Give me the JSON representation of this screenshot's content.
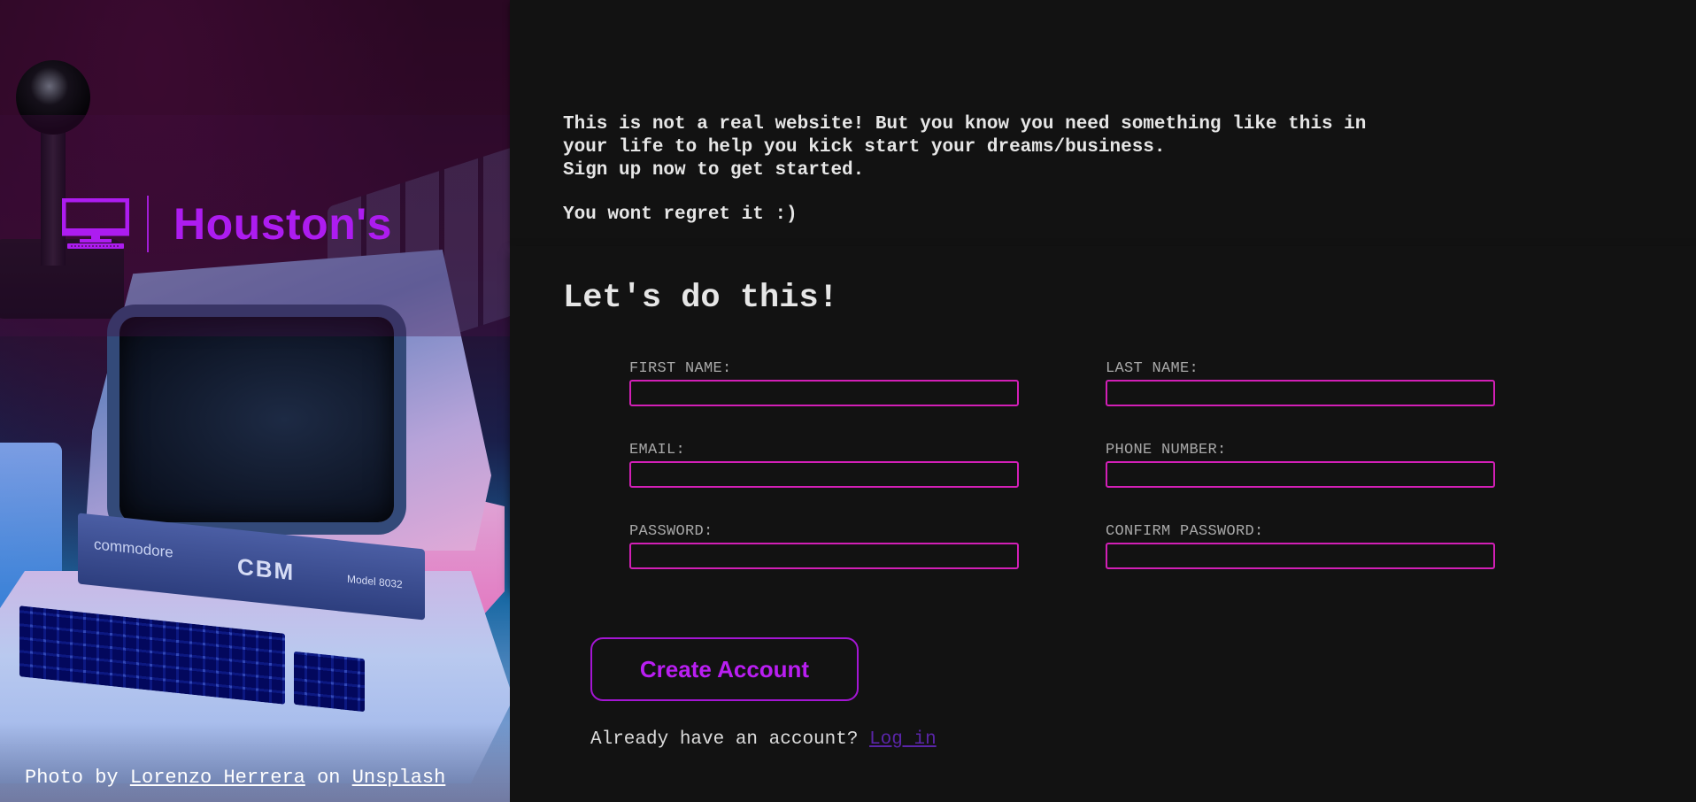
{
  "brand": {
    "name": "Houston's",
    "icon": "computer-monitor-icon",
    "color": "#ad1cf0"
  },
  "hero": {
    "photo_subject": "commodore-cbm-computer-photo",
    "plate_brand": "commodore",
    "plate_cbm": "CBM",
    "plate_model": "Model 8032",
    "credit_prefix": "Photo by ",
    "credit_author": "Lorenzo Herrera",
    "credit_middle": " on ",
    "credit_source": "Unsplash"
  },
  "intro": {
    "paragraph": "This is not a real website! But you know you need something like this in\nyour life to help you kick start your dreams/business.\nSign up now to get started.",
    "tagline": "You wont regret it :)"
  },
  "form": {
    "title": "Let's do this!",
    "fields": {
      "first_name": {
        "label": "FIRST NAME:",
        "value": ""
      },
      "last_name": {
        "label": "LAST NAME:",
        "value": ""
      },
      "email": {
        "label": "EMAIL:",
        "value": ""
      },
      "phone": {
        "label": "PHONE NUMBER:",
        "value": ""
      },
      "password": {
        "label": "PASSWORD:",
        "value": ""
      },
      "confirm_password": {
        "label": "CONFIRM PASSWORD:",
        "value": ""
      }
    },
    "input_border_color": "#d21fb6"
  },
  "cta": {
    "create_label": "Create Account",
    "login_prompt": "Already have an account? ",
    "login_link": "Log in",
    "accent": "#b91ef2"
  }
}
